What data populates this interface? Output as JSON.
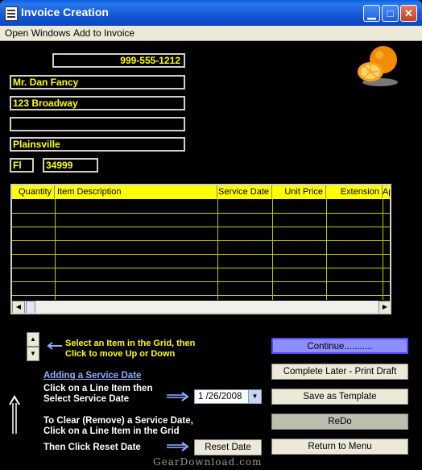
{
  "window": {
    "title": "Invoice Creation"
  },
  "menu": {
    "items": [
      "Open Windows",
      "Add to Invoice"
    ]
  },
  "customer": {
    "phone": "999-555-1212",
    "name": "Mr. Dan   Fancy",
    "address1": "123 Broadway",
    "address2": "",
    "city": "Plainsville",
    "state": "Fl",
    "zip": "34999"
  },
  "grid": {
    "columns": [
      "Quantity",
      "Item Description",
      "Service Date",
      "Unit Price",
      "Extension",
      "Ap"
    ]
  },
  "instructions": {
    "move_item": "Select an Item in the Grid, then Click to move Up or Down",
    "move_item_line1": "Select an Item in the Grid, then",
    "move_item_line2": "Click to move Up or Down",
    "service_date_link": "Adding a Service Date",
    "service_line1": "Click on a Line Item then",
    "service_line2": "Select Service Date",
    "clear_line1": "To Clear (Remove) a Service Date,",
    "clear_line2": "Click on a Line Item in the Grid",
    "reset_line": "Then Click Reset Date"
  },
  "date_picker": {
    "value": "1 /26/2008"
  },
  "buttons": {
    "continue": "Continue...........",
    "complete_later": "Complete Later - Print Draft Copy",
    "save_template": "Save as Template",
    "redo": "ReDo",
    "return_menu": "Return to Menu",
    "reset_date": "Reset Date"
  },
  "watermark": "GearDownload.com",
  "icons": {
    "logo": "orange-fruit-icon"
  },
  "colors": {
    "field_text": "#ffff00",
    "grid_header": "#ffff00",
    "continue_bg": "#8e8eff"
  }
}
